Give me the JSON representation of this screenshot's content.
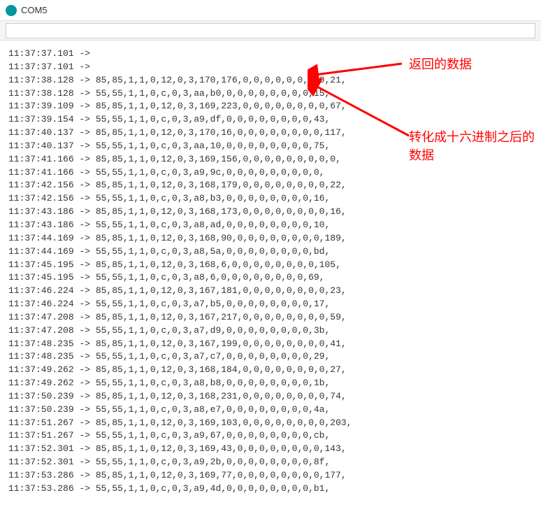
{
  "window": {
    "title": "COM5"
  },
  "input": {
    "value": ""
  },
  "log_lines": [
    "11:37:37.101 ->",
    "11:37:37.101 ->",
    "11:37:38.128 -> 85,85,1,1,0,12,0,3,170,176,0,0,0,0,0,0,0,0,21,",
    "11:37:38.128 -> 55,55,1,1,0,c,0,3,aa,b0,0,0,0,0,0,0,0,0,15,",
    "11:37:39.109 -> 85,85,1,1,0,12,0,3,169,223,0,0,0,0,0,0,0,0,67,",
    "11:37:39.154 -> 55,55,1,1,0,c,0,3,a9,df,0,0,0,0,0,0,0,0,43,",
    "11:37:40.137 -> 85,85,1,1,0,12,0,3,170,16,0,0,0,0,0,0,0,0,117,",
    "11:37:40.137 -> 55,55,1,1,0,c,0,3,aa,10,0,0,0,0,0,0,0,0,75,",
    "11:37:41.166 -> 85,85,1,1,0,12,0,3,169,156,0,0,0,0,0,0,0,0,0,",
    "11:37:41.166 -> 55,55,1,1,0,c,0,3,a9,9c,0,0,0,0,0,0,0,0,0,",
    "11:37:42.156 -> 85,85,1,1,0,12,0,3,168,179,0,0,0,0,0,0,0,0,22,",
    "11:37:42.156 -> 55,55,1,1,0,c,0,3,a8,b3,0,0,0,0,0,0,0,0,16,",
    "11:37:43.186 -> 85,85,1,1,0,12,0,3,168,173,0,0,0,0,0,0,0,0,16,",
    "11:37:43.186 -> 55,55,1,1,0,c,0,3,a8,ad,0,0,0,0,0,0,0,0,10,",
    "11:37:44.169 -> 85,85,1,1,0,12,0,3,168,90,0,0,0,0,0,0,0,0,189,",
    "11:37:44.169 -> 55,55,1,1,0,c,0,3,a8,5a,0,0,0,0,0,0,0,0,bd,",
    "11:37:45.195 -> 85,85,1,1,0,12,0,3,168,6,0,0,0,0,0,0,0,0,105,",
    "11:37:45.195 -> 55,55,1,1,0,c,0,3,a8,6,0,0,0,0,0,0,0,0,69,",
    "11:37:46.224 -> 85,85,1,1,0,12,0,3,167,181,0,0,0,0,0,0,0,0,23,",
    "11:37:46.224 -> 55,55,1,1,0,c,0,3,a7,b5,0,0,0,0,0,0,0,0,17,",
    "11:37:47.208 -> 85,85,1,1,0,12,0,3,167,217,0,0,0,0,0,0,0,0,59,",
    "11:37:47.208 -> 55,55,1,1,0,c,0,3,a7,d9,0,0,0,0,0,0,0,0,3b,",
    "11:37:48.235 -> 85,85,1,1,0,12,0,3,167,199,0,0,0,0,0,0,0,0,41,",
    "11:37:48.235 -> 55,55,1,1,0,c,0,3,a7,c7,0,0,0,0,0,0,0,0,29,",
    "11:37:49.262 -> 85,85,1,1,0,12,0,3,168,184,0,0,0,0,0,0,0,0,27,",
    "11:37:49.262 -> 55,55,1,1,0,c,0,3,a8,b8,0,0,0,0,0,0,0,0,1b,",
    "11:37:50.239 -> 85,85,1,1,0,12,0,3,168,231,0,0,0,0,0,0,0,0,74,",
    "11:37:50.239 -> 55,55,1,1,0,c,0,3,a8,e7,0,0,0,0,0,0,0,0,4a,",
    "11:37:51.267 -> 85,85,1,1,0,12,0,3,169,103,0,0,0,0,0,0,0,0,203,",
    "11:37:51.267 -> 55,55,1,1,0,c,0,3,a9,67,0,0,0,0,0,0,0,0,cb,",
    "11:37:52.301 -> 85,85,1,1,0,12,0,3,169,43,0,0,0,0,0,0,0,0,143,",
    "11:37:52.301 -> 55,55,1,1,0,c,0,3,a9,2b,0,0,0,0,0,0,0,0,8f,",
    "11:37:53.286 -> 85,85,1,1,0,12,0,3,169,77,0,0,0,0,0,0,0,0,177,",
    "11:37:53.286 -> 55,55,1,1,0,c,0,3,a9,4d,0,0,0,0,0,0,0,0,b1,"
  ],
  "annotations": {
    "label1": "返回的数据",
    "label2": "转化成十六进制之后的数据"
  }
}
